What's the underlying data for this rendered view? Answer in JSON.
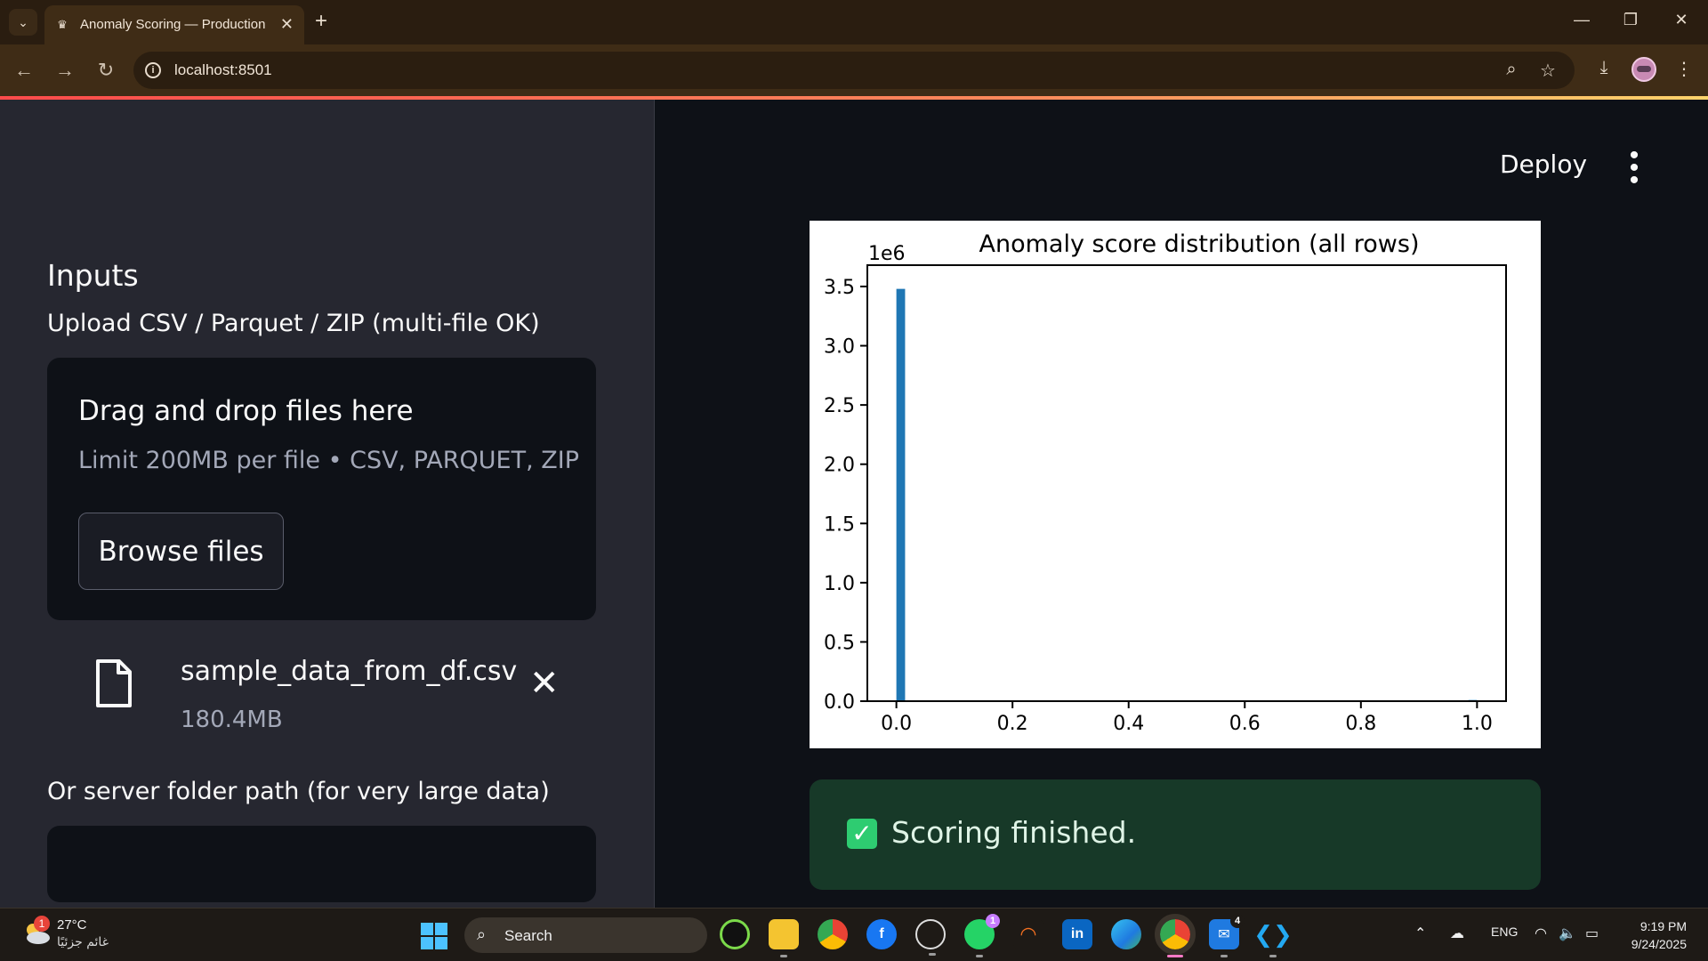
{
  "browser": {
    "tab_title": "Anomaly Scoring — Production",
    "tab_close": "✕",
    "new_tab": "+",
    "url": "localhost:8501"
  },
  "sidebar": {
    "heading": "Inputs",
    "upload_label": "Upload CSV / Parquet / ZIP (multi-file OK)",
    "dropzone_title": "Drag and drop files here",
    "dropzone_limit": "Limit 200MB per file • CSV, PARQUET, ZIP",
    "browse_button": "Browse files",
    "uploaded_file": {
      "name": "sample_data_from_df.csv",
      "size": "180.4MB"
    },
    "server_path_label": "Or server folder path (for very large data)",
    "server_path_value": ""
  },
  "main": {
    "deploy_label": "Deploy",
    "success_message": "Scoring finished.",
    "success_color": "#2ecc71"
  },
  "chart_data": {
    "type": "bar",
    "title": "Anomaly score distribution (all rows)",
    "xlabel": "",
    "ylabel": "",
    "y_offset_label": "1e6",
    "xlim": [
      -0.05,
      1.05
    ],
    "ylim": [
      0,
      3.68
    ],
    "xticks": [
      "0.0",
      "0.2",
      "0.4",
      "0.6",
      "0.8",
      "1.0"
    ],
    "yticks": [
      "0.0",
      "0.5",
      "1.0",
      "1.5",
      "2.0",
      "2.5",
      "3.0",
      "3.5"
    ],
    "bins": [
      {
        "x0": 0.0,
        "x1": 0.015,
        "value": 3.48
      },
      {
        "x0": 0.985,
        "x1": 1.0,
        "value": 0.01
      }
    ],
    "bar_color": "#1f77b4",
    "grid": false
  },
  "taskbar": {
    "weather_temp": "27°C",
    "weather_desc": "غائم جزئيًا",
    "weather_badge": "1",
    "search_label": "Search",
    "whatsapp_badge": "1",
    "mail_badge": "4",
    "language": "ENG",
    "time": "9:19 PM",
    "date": "9/24/2025"
  }
}
